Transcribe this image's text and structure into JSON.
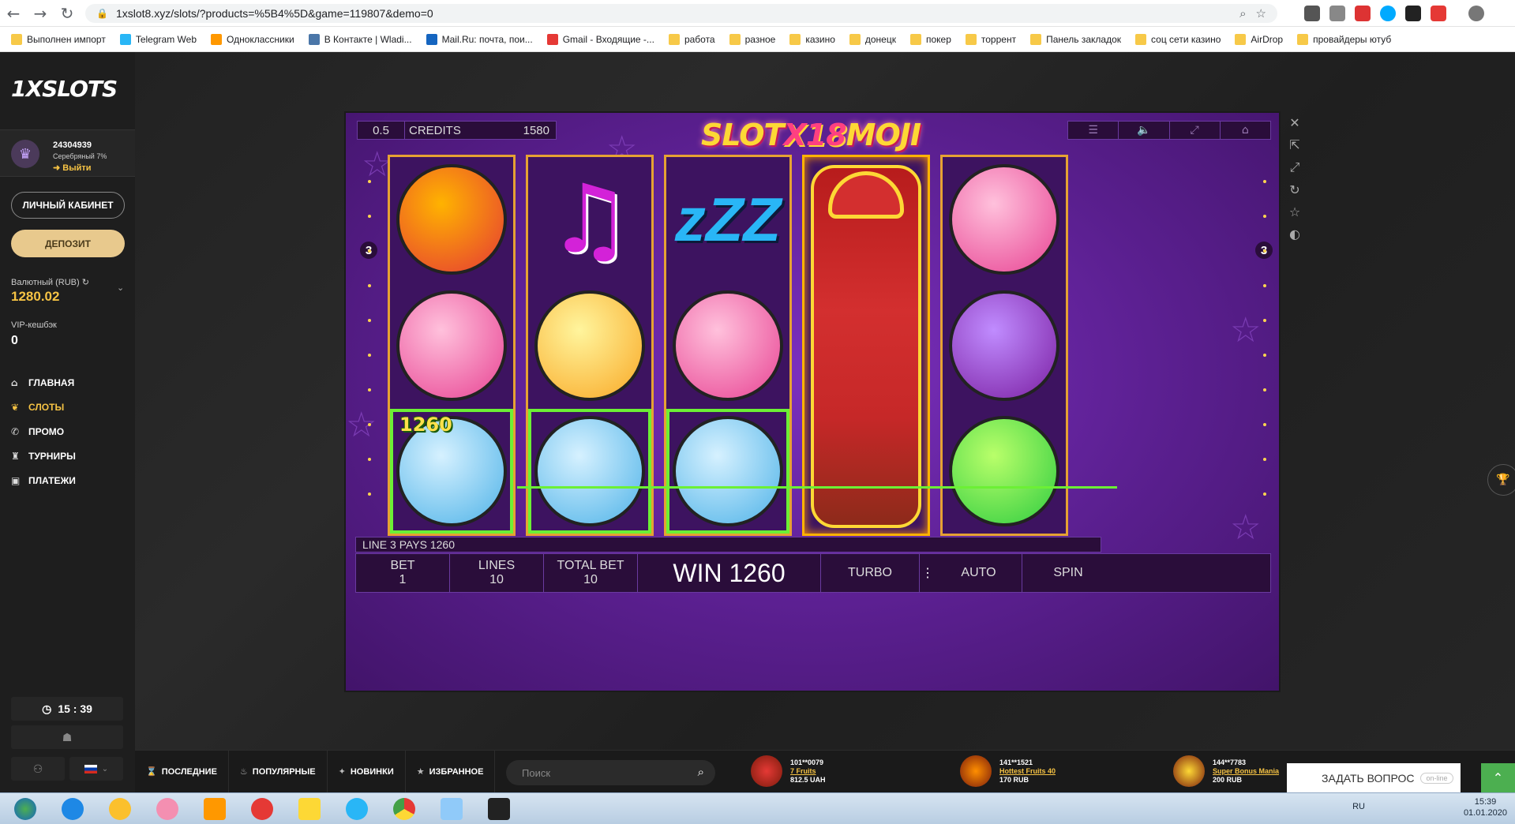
{
  "browser": {
    "url": "1xslot8.xyz/slots/?products=%5B4%5D&game=119807&demo=0",
    "bookmarks": [
      "Выполнен импорт",
      "Telegram Web",
      "Одноклассники",
      "В Контакте | Wladi...",
      "Mail.Ru: почта, пои...",
      "Gmail - Входящие -...",
      "работа",
      "разное",
      "казино",
      "донецк",
      "покер",
      "торрент",
      "Панель закладок",
      "соц сети казино",
      "AirDrop",
      "провайдеры ютуб"
    ]
  },
  "sidebar": {
    "logo": "1XSLOTS",
    "user_id": "24304939",
    "level": "Серебряный 7%",
    "logout": "Выйти",
    "cabinet_btn": "ЛИЧНЫЙ КАБИНЕТ",
    "deposit_btn": "ДЕПОЗИТ",
    "balance_label": "Валютный (RUB)",
    "balance_value": "1280.02",
    "vip_label": "VIP-кешбэк",
    "vip_value": "0",
    "menu": [
      {
        "label": "ГЛАВНАЯ",
        "icon": "home-icon"
      },
      {
        "label": "СЛОТЫ",
        "icon": "cherries-icon"
      },
      {
        "label": "ПРОМО",
        "icon": "megaphone-icon"
      },
      {
        "label": "ТУРНИРЫ",
        "icon": "trophy-icon"
      },
      {
        "label": "ПЛАТЕЖИ",
        "icon": "wallet-icon"
      }
    ],
    "clock": "15 : 39"
  },
  "game": {
    "bet_per_line": "0.5",
    "credits_label": "CREDITS",
    "credits_value": "1580",
    "logo_a": "SLOT",
    "logo_b": "X18",
    "logo_c": "MOJI",
    "line_number_left": "3",
    "line_number_right": "3",
    "win_label_cell": "1260",
    "pays_text": "LINE 3 PAYS 1260",
    "bet_label": "BET",
    "bet_value": "1",
    "lines_label": "LINES",
    "lines_value": "10",
    "total_bet_label": "TOTAL BET",
    "total_bet_value": "10",
    "win_text": "WIN 1260",
    "turbo_label": "TURBO",
    "auto_label": "AUTO",
    "spin_label": "SPIN"
  },
  "bottom": {
    "tabs": [
      {
        "label": "ПОСЛЕДНИЕ",
        "icon": "hourglass-icon"
      },
      {
        "label": "ПОПУЛЯРНЫЕ",
        "icon": "flame-icon"
      },
      {
        "label": "НОВИНКИ",
        "icon": "sparkle-icon"
      },
      {
        "label": "ИЗБРАННОЕ",
        "icon": "star-icon"
      }
    ],
    "search_placeholder": "Поиск",
    "winners": [
      {
        "user": "101**0079",
        "game": "7 Fruits",
        "amount": "812.5 UAH"
      },
      {
        "user": "141**1521",
        "game": "Hottest Fruits 40",
        "amount": "170 RUB"
      },
      {
        "user": "144**7783",
        "game": "Super Bonus Mania",
        "amount": "200 RUB"
      }
    ],
    "ask_label": "ЗАДАТЬ ВОПРОС",
    "online_label": "on-line"
  },
  "taskbar": {
    "lang": "RU",
    "time": "15:39",
    "date": "01.01.2020"
  },
  "colors": {
    "accent_gold": "#f6c344",
    "slot_purple": "#5a1f8f",
    "win_green": "#6cf035"
  }
}
